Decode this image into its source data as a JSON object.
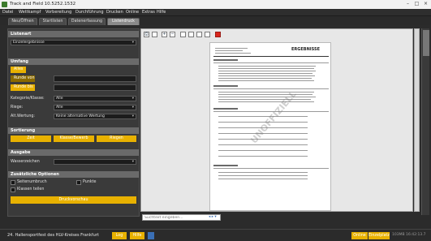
{
  "window": {
    "title": "Track and Field 10.5252.1532"
  },
  "menu": [
    "Datei",
    "Wettkampf",
    "Vorbereitung",
    "Durchführung",
    "Drucken",
    "Online",
    "Extras",
    "Hilfe"
  ],
  "tabs": [
    "Neu/Öffnen",
    "Startlisten",
    "Datenerfassung",
    "Listendruck"
  ],
  "left_panel": {
    "listenart": {
      "header": "Listenart",
      "value": "Einzelergebnisse"
    },
    "umfang": {
      "header": "Umfang",
      "alles": "Alles",
      "runde_von": "Runde von",
      "runde_bis": "Runde bis",
      "kategorie_label": "Kategorie/Klasse:",
      "kategorie_value": "Alle",
      "riege_label": "Riege:",
      "riege_value": "Alle",
      "alt_wertung_label": "Alt.Wertung:",
      "alt_wertung_value": "Keine alternative Wertung"
    },
    "sortierung": {
      "header": "Sortierung",
      "options": [
        "Zeit",
        "Klasse/Bewerb",
        "Riegen"
      ]
    },
    "ausgabe": {
      "header": "Ausgabe",
      "wasserzeichen_label": "Wasserzeichen"
    },
    "zusaetzliche": {
      "header": "Zusätzliche Optionen",
      "seitenumbruch": "Seitenumbruch",
      "punkte": "Punkte",
      "klassen_teilen": "Klassen teilen",
      "druckvorschau": "Druckvorschau"
    }
  },
  "preview": {
    "doc_title": "ERGEBNISSE",
    "watermark": "UNOFFIZIELL",
    "search_placeholder": "Suchtext eingeben...",
    "search_nav": "◂ ▸ ▾"
  },
  "statusbar": {
    "event": "24. Hallensportfest des HLV-Kreises  Frankfurt",
    "log": "Log",
    "hilfe": "Hilfe",
    "online": "Online",
    "einzelplatz": "Einzelplatz",
    "mem": "103MB",
    "time": "16:42:13.7"
  },
  "colors": {
    "accent": "#e8b100",
    "panel": "#3a3a3a",
    "section_header": "#6a6a6a"
  }
}
